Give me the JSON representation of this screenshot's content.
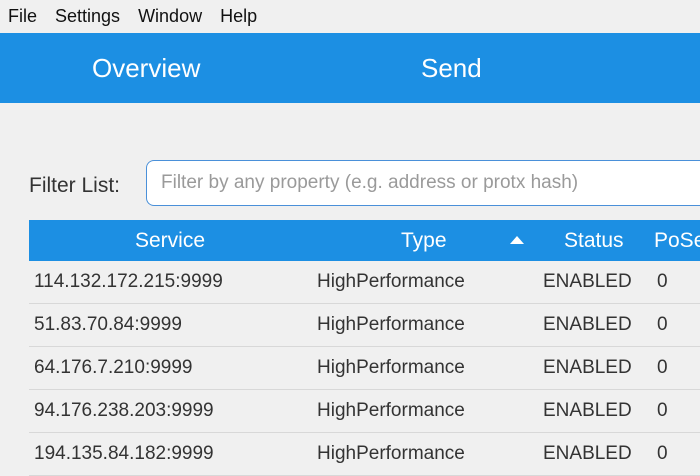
{
  "menu": {
    "items": [
      "File",
      "Settings",
      "Window",
      "Help"
    ]
  },
  "tabs": [
    {
      "label": "Overview"
    },
    {
      "label": "Send"
    }
  ],
  "filter": {
    "label": "Filter List:",
    "placeholder": "Filter by any property (e.g. address or protx hash)",
    "value": ""
  },
  "table": {
    "columns": {
      "service": "Service",
      "type": "Type",
      "status": "Status",
      "pose": "PoSe"
    },
    "sort": {
      "column": "Type",
      "direction": "ascending"
    },
    "rows": [
      {
        "service": "114.132.172.215:9999",
        "type": "HighPerformance",
        "status": "ENABLED",
        "pose": "0"
      },
      {
        "service": "51.83.70.84:9999",
        "type": "HighPerformance",
        "status": "ENABLED",
        "pose": "0"
      },
      {
        "service": "64.176.7.210:9999",
        "type": "HighPerformance",
        "status": "ENABLED",
        "pose": "0"
      },
      {
        "service": "94.176.238.203:9999",
        "type": "HighPerformance",
        "status": "ENABLED",
        "pose": "0"
      },
      {
        "service": "194.135.84.182:9999",
        "type": "HighPerformance",
        "status": "ENABLED",
        "pose": "0"
      }
    ]
  },
  "colors": {
    "accent": "#1c8fe3",
    "background": "#f0f0f0",
    "input_border": "#4a90d9"
  }
}
